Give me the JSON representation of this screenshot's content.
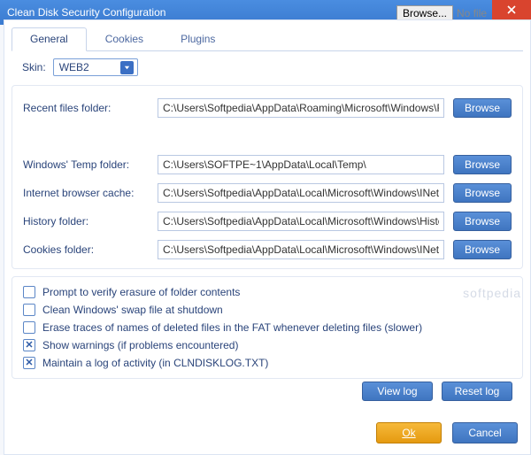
{
  "titlebar": {
    "title": "Clean Disk Security Configuration"
  },
  "bg": {
    "clean": "Clean",
    "browse": "Browse...",
    "nofile": "No file selected."
  },
  "tabs": {
    "general": "General",
    "cookies": "Cookies",
    "plugins": "Plugins"
  },
  "skin": {
    "label": "Skin:",
    "value": "WEB2"
  },
  "fields": {
    "recent": {
      "label": "Recent files folder:",
      "value": "C:\\Users\\Softpedia\\AppData\\Roaming\\Microsoft\\Windows\\R"
    },
    "temp": {
      "label": "Windows' Temp folder:",
      "value": "C:\\Users\\SOFTPE~1\\AppData\\Local\\Temp\\"
    },
    "cache": {
      "label": "Internet browser cache:",
      "value": "C:\\Users\\Softpedia\\AppData\\Local\\Microsoft\\Windows\\INet"
    },
    "history": {
      "label": "History folder:",
      "value": "C:\\Users\\Softpedia\\AppData\\Local\\Microsoft\\Windows\\Histo"
    },
    "cookies": {
      "label": "Cookies folder:",
      "value": "C:\\Users\\Softpedia\\AppData\\Local\\Microsoft\\Windows\\INet"
    }
  },
  "browse_label": "Browse",
  "checks": {
    "prompt": {
      "label": "Prompt to verify erasure of folder contents",
      "checked": false
    },
    "swap": {
      "label": "Clean Windows' swap file at shutdown",
      "checked": false
    },
    "fat": {
      "label": "Erase traces of names of deleted files in the FAT whenever deleting files (slower)",
      "checked": false
    },
    "warn": {
      "label": "Show warnings (if problems encountered)",
      "checked": true
    },
    "log": {
      "label": "Maintain a log of activity (in CLNDISKLOG.TXT)",
      "checked": true
    }
  },
  "buttons": {
    "viewlog": "View log",
    "resetlog": "Reset log",
    "ok": "Ok",
    "cancel": "Cancel"
  },
  "watermark": "softpedia"
}
